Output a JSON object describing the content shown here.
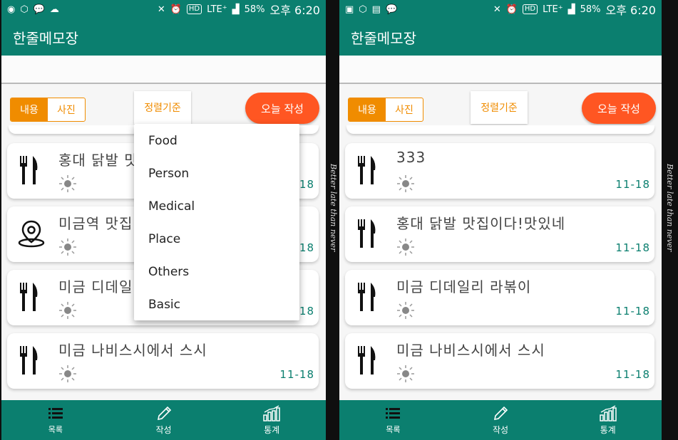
{
  "status_bar": {
    "lte": "LTE⁺",
    "battery": "58%",
    "time": "오후 6:20",
    "hd": "HD",
    "icons": [
      "app-icon",
      "shield-icon",
      "talk-icon",
      "chat-icon",
      "mute-icon",
      "alarm-icon",
      "signal-icon"
    ]
  },
  "app": {
    "title": "한줄메모장",
    "toggle": {
      "content": "내용",
      "photo": "사진"
    },
    "sort_label": "정렬기준",
    "today_write_label": "오늘 작성"
  },
  "dropdown": {
    "options": [
      "Food",
      "Person",
      "Medical",
      "Place",
      "Others",
      "Basic"
    ]
  },
  "left_list": [
    {
      "icon": "fork-knife-icon",
      "title": "홍대 닭발 맛",
      "date": "11-18"
    },
    {
      "icon": "map-pin-icon",
      "title": "미금역 맛집",
      "date": "11-18"
    },
    {
      "icon": "fork-knife-icon",
      "title": "미금 디데일",
      "date": "11-18"
    },
    {
      "icon": "fork-knife-icon",
      "title": "미금 나비스시에서 스시",
      "date": "11-18"
    }
  ],
  "right_list": [
    {
      "icon": "fork-knife-icon",
      "title": "333",
      "date": "11-18"
    },
    {
      "icon": "fork-knife-icon",
      "title": "홍대 닭발 맛집이다!맛있네",
      "date": "11-18"
    },
    {
      "icon": "fork-knife-icon",
      "title": "미금 디데일리 라볶이",
      "date": "11-18"
    },
    {
      "icon": "fork-knife-icon",
      "title": "미금 나비스시에서 스시",
      "date": "11-18"
    }
  ],
  "bottom_nav": [
    {
      "label": "목록",
      "icon": "list-icon"
    },
    {
      "label": "작성",
      "icon": "pencil-icon"
    },
    {
      "label": "통계",
      "icon": "chart-icon"
    }
  ],
  "side_text": "Better late than never",
  "colors": {
    "primary": "#0b7f6f",
    "accent": "#f08c00",
    "today_button": "#ff5622"
  }
}
